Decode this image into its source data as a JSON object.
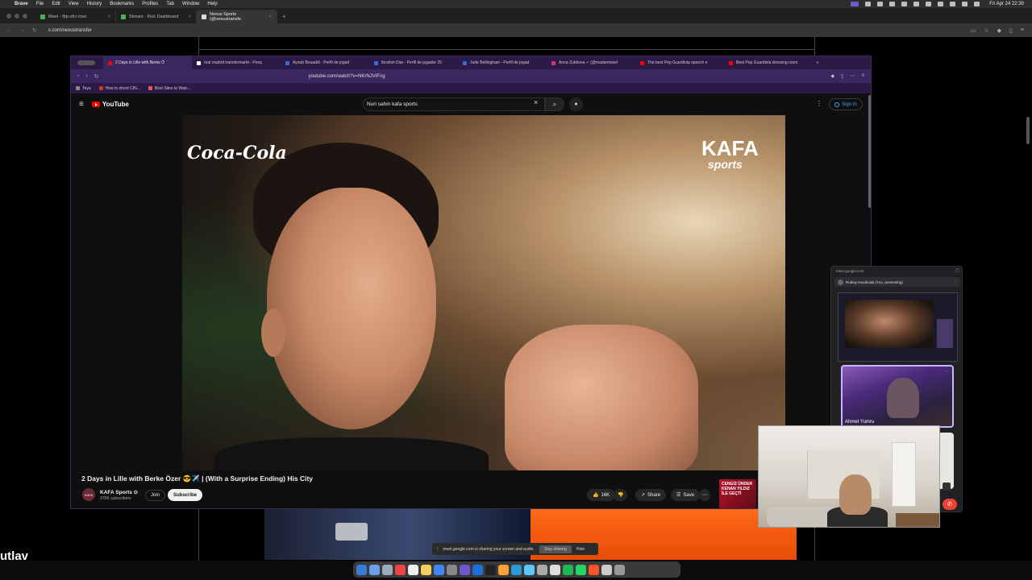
{
  "menubar": {
    "app": "Brave",
    "items": [
      "File",
      "Edit",
      "View",
      "History",
      "Bookmarks",
      "Profiles",
      "Tab",
      "Window",
      "Help"
    ],
    "clock": "Fri Apr 24  22:30"
  },
  "outer_browser": {
    "tabs": [
      {
        "label": "Meet - fbp-xfcr-mec"
      },
      {
        "label": "Stream · Kick Dashboard"
      },
      {
        "label": "Nexus Sports (@nexustransfe"
      }
    ],
    "url": "x.com/nexustransfer",
    "brand_fragment": "utlav"
  },
  "inner_browser": {
    "tabs": [
      {
        "label": "2 Days in Lille with Berke Ö"
      },
      {
        "label": "real madrid transfermarkt - Pesq"
      },
      {
        "label": "Ayoub Bouaddi - Perfil de jogad"
      },
      {
        "label": "Ibrahim Diar - Perfil de jugador 25"
      },
      {
        "label": "Jude Bellingham - Perfil de jogad"
      },
      {
        "label": "Anna Zubkova ✓ (@madamoisel"
      },
      {
        "label": "The best Pep Guardiola speech e"
      },
      {
        "label": "Best Pep Guardiola dressing room"
      }
    ],
    "url": "youtube.com/watch?v=NKrNJVIFng",
    "bookmarks": [
      "Teya",
      "How to shoot CIN...",
      "Best Sites to Watc..."
    ]
  },
  "youtube": {
    "logo": "YouTube",
    "search_value": "Nuri sahin kafa sports",
    "signin": "Sign In",
    "video_overlay_left": "Coca-Cola",
    "video_overlay_right_main": "KAFA",
    "video_overlay_right_sub": "sports",
    "title": "2 Days in Lille with Berke Özer 😎✈️ | (With a Surprise Ending) His City",
    "channel": "KAFA Sports ⊙",
    "subscribers": "376K subscribers",
    "join": "Join",
    "subscribe": "Subscribe",
    "likes": "16K",
    "share": "Share",
    "save": "Save",
    "ad_text": "CENGİZ ÜNDER KENAN YILDIZ İLE GEÇTİ"
  },
  "meet": {
    "url": "meet.google.com",
    "presenter": "Rutkay Karabulak (You, presenting)",
    "participant": "Ahmet Yumru"
  },
  "share_bar": {
    "text": "meet.google.com is sharing your screen and audio.",
    "stop": "Stop sharing",
    "hide": "Hide"
  },
  "colors": {
    "yt_red": "#ff0000",
    "inner_chrome": "#3b2760",
    "meet_border": "#c8b4ff",
    "end_call": "#ea4335"
  }
}
